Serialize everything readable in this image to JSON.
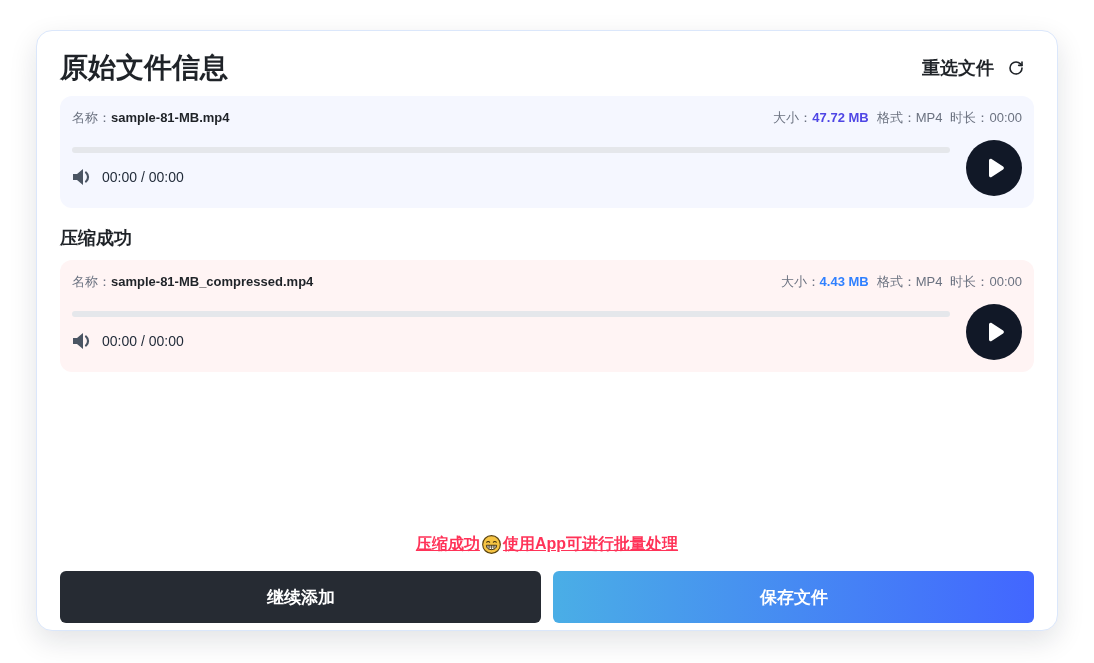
{
  "sections": [
    {
      "kind": "original",
      "title": "原始文件信息",
      "action": "重选文件",
      "file": {
        "name_label": "名称：",
        "name": "sample-81-MB.mp4",
        "size_label": "大小：",
        "size": "47.72 MB",
        "format_label": "格式：",
        "format": "MP4",
        "duration_label": "时长：",
        "duration": "00:00",
        "time": "00:00 / 00:00"
      }
    },
    {
      "kind": "compressed",
      "title": "压缩成功",
      "file": {
        "name_label": "名称：",
        "name": "sample-81-MB_compressed.mp4",
        "size_label": "大小：",
        "size": "4.43 MB",
        "format_label": "格式：",
        "format": "MP4",
        "duration_label": "时长：",
        "duration": "00:00",
        "time": "00:00 / 00:00"
      }
    }
  ],
  "promo_link": {
    "lead": "压缩成功",
    "text": "使用App可进行批量处理"
  },
  "buttons": [
    {
      "kind": "secondary",
      "label": "继续添加"
    },
    {
      "kind": "primary",
      "label": "保存文件"
    }
  ]
}
